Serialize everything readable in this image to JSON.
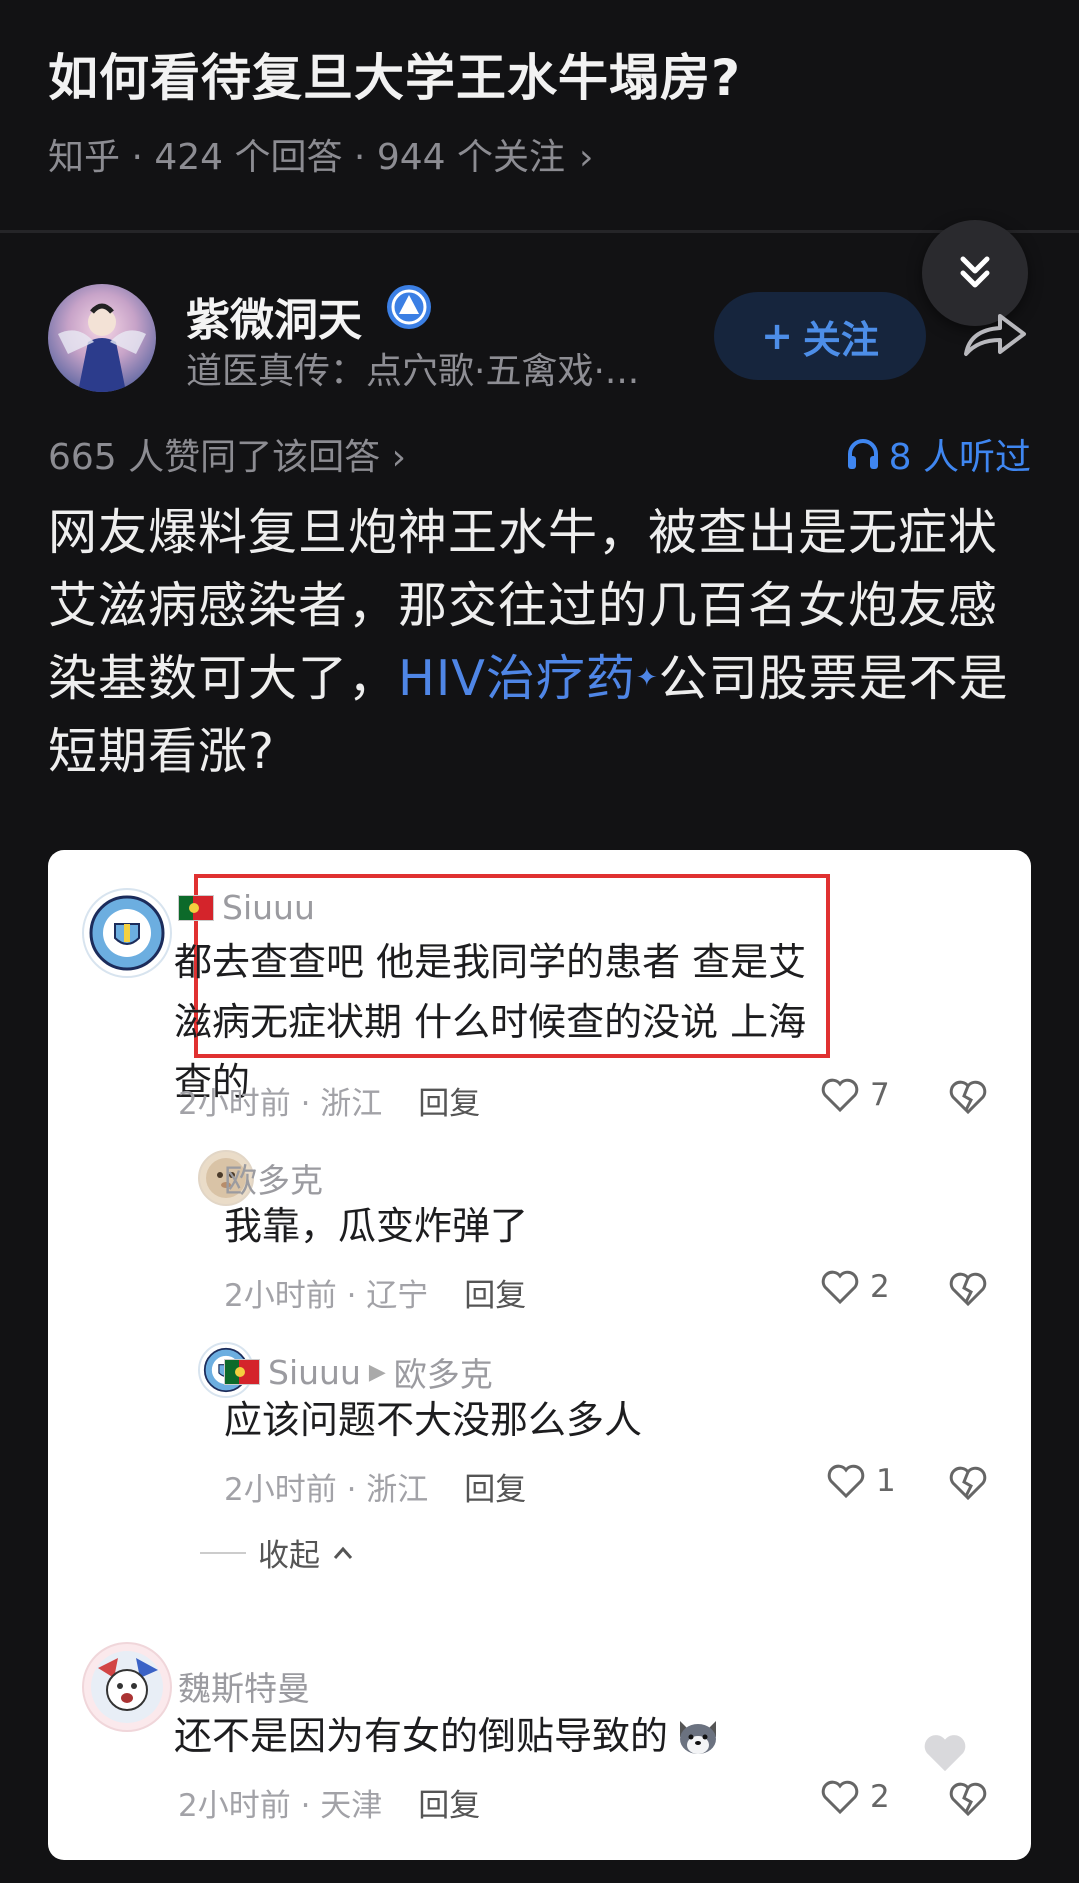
{
  "question": {
    "title": "如何看待复旦大学王水牛塌房?",
    "meta": "知乎 · 424 个回答 · 944 个关注",
    "chevron": "›"
  },
  "author": {
    "name": "紫微洞天",
    "bio": "道医真传：点穴歌·五禽戏·...",
    "follow_label": "关注",
    "follow_plus": "+"
  },
  "stats": {
    "agree": "665 人赞同了该回答 ›",
    "listened": "8 人听过"
  },
  "answer": {
    "text_before": "网友爆料复旦炮神王水牛，被查出是无症状艾滋病感染者，那交往过的几百名女炮友感染基数可大了，",
    "link_text": "HIV治疗药",
    "text_after": "公司股票是不是短期看涨?"
  },
  "comments": [
    {
      "user": "Siuuu",
      "body": "都去查查吧 他是我同学的患者 查是艾滋病无症状期 什么时候查的没说 上海查的",
      "meta": "2小时前 · 浙江",
      "reply": "回复",
      "likes": "7"
    },
    {
      "user": "欧多克",
      "body": "我靠，瓜变炸弹了",
      "meta": "2小时前 · 辽宁",
      "reply": "回复",
      "likes": "2"
    },
    {
      "user": "Siuuu",
      "reply_to": "欧多克",
      "body": "应该问题不大没那么多人",
      "meta": "2小时前 · 浙江",
      "reply": "回复",
      "likes": "1"
    },
    {
      "user": "魏斯特曼",
      "body": "还不是因为有女的倒贴导致的",
      "meta": "2小时前 · 天津",
      "reply": "回复",
      "likes": "2"
    }
  ],
  "collapse_label": "收起",
  "colors": {
    "accent": "#4d8ee8",
    "highlight_border": "#e03131",
    "background": "#121214"
  },
  "icons": [
    "double-chevron-down-icon",
    "verified-badge-icon",
    "share-icon",
    "headphones-icon",
    "heart-icon",
    "broken-heart-icon",
    "portugal-flag-icon",
    "manchester-city-badge-icon"
  ]
}
